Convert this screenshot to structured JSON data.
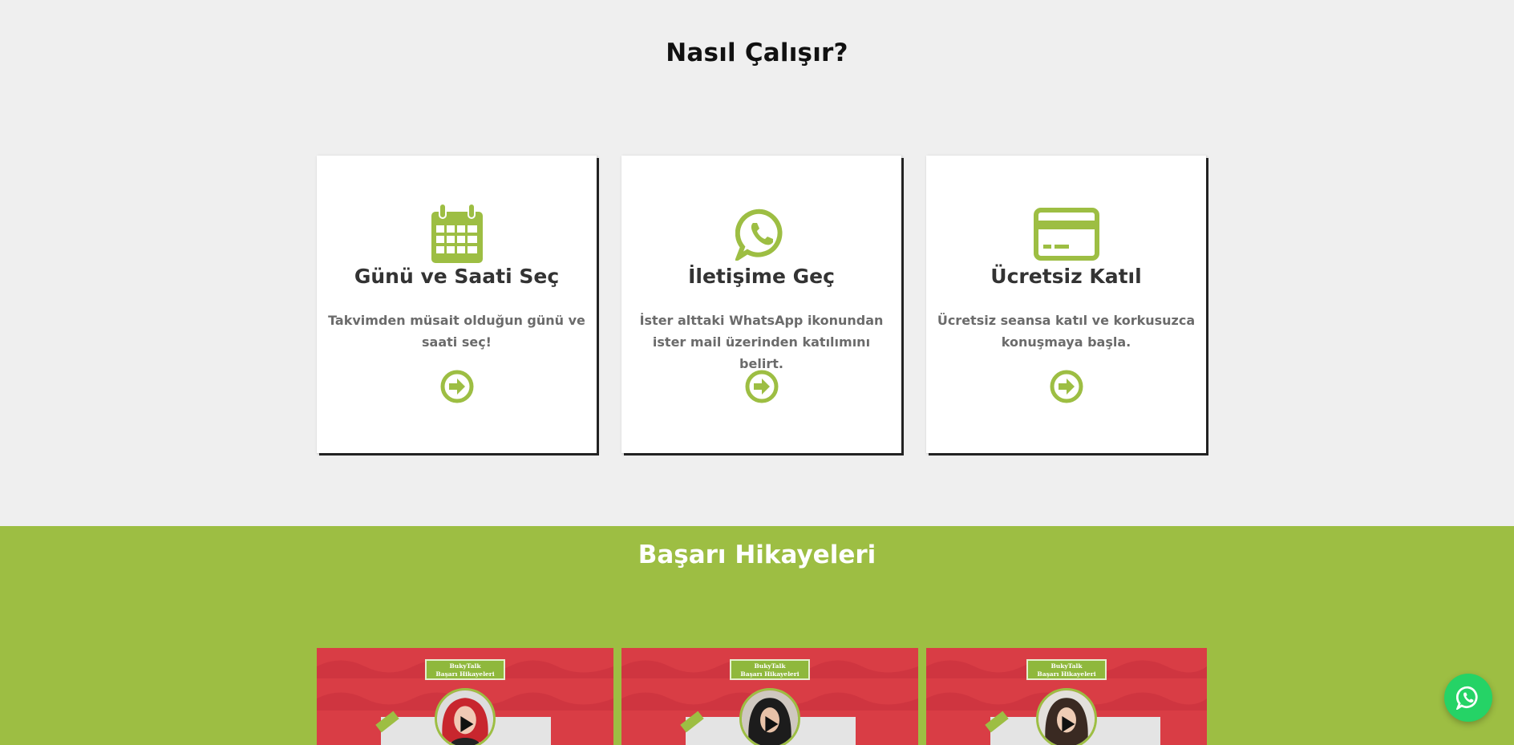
{
  "how_it_works": {
    "title": "Nasıl Çalışır?",
    "steps": [
      {
        "icon": "calendar-icon",
        "title": "Günü ve Saati Seç",
        "description": "Takvimden müsait olduğun günü ve saati seç!"
      },
      {
        "icon": "whatsapp-icon",
        "title": "İletişime Geç",
        "description": "İster alttaki WhatsApp ikonundan ister mail üzerinden katılımını belirt."
      },
      {
        "icon": "credit-card-icon",
        "title": "Ücretsiz Katıl",
        "description": "Ücretsiz seansa katıl ve korkusuzca konuşmaya başla."
      }
    ]
  },
  "success_stories": {
    "title": "Başarı Hikayeleri",
    "ribbon_line1": "BukyTalk",
    "ribbon_line2": "Başarı Hikayeleri"
  },
  "colors": {
    "accent": "#9dbe43",
    "card_red": "#d93d45",
    "whatsapp": "#25d366"
  }
}
